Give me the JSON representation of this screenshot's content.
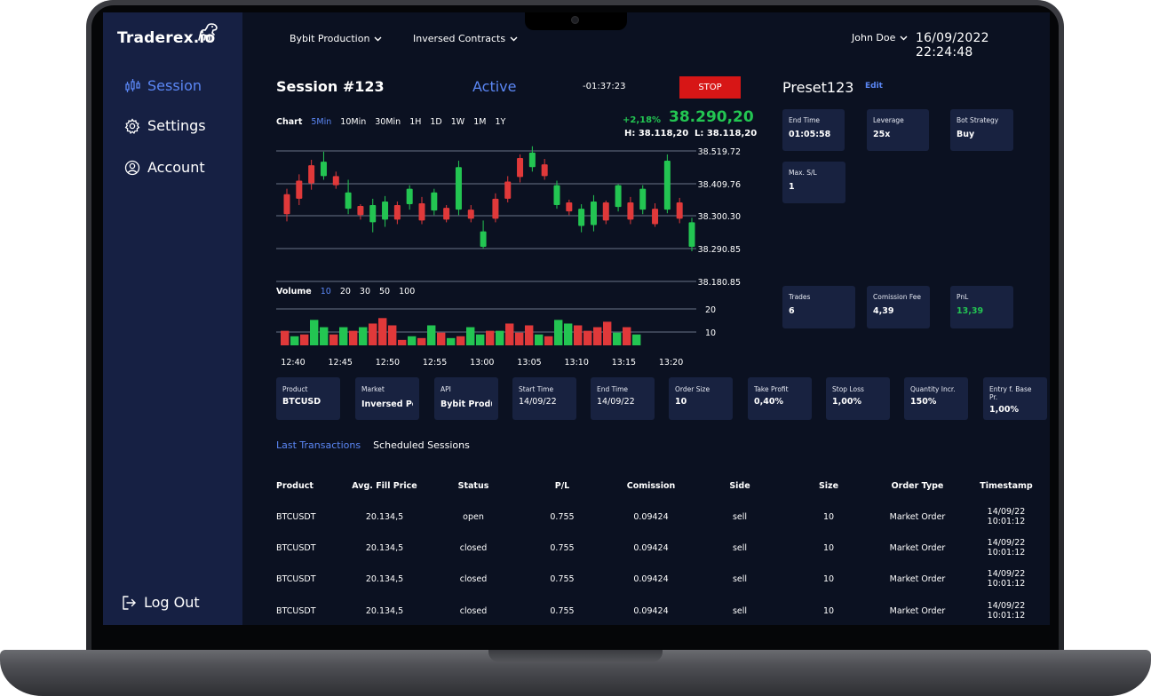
{
  "app": {
    "name": "Traderex.io",
    "accent": "#5b87f5",
    "positive": "#23c552",
    "danger": "#d71616",
    "sidebar_bg": "#162043",
    "screen_bg": "#0b1121",
    "card_bg": "#182240"
  },
  "sidebar": {
    "items": [
      {
        "label": "Session",
        "icon": "candlestick-icon",
        "active": true
      },
      {
        "label": "Settings",
        "icon": "gear-icon",
        "active": false
      },
      {
        "label": "Account",
        "icon": "user-circle-icon",
        "active": false
      }
    ],
    "logout": {
      "label": "Log Out",
      "icon": "logout-icon"
    }
  },
  "topbar": {
    "environment": "Bybit Production",
    "contracts": "Inversed Contracts",
    "user": "John Doe",
    "datetime": "16/09/2022 22:24:48"
  },
  "session": {
    "title": "Session #123",
    "status": "Active",
    "timer": "-01:37:23",
    "stop_label": "STOP"
  },
  "chart": {
    "label": "Chart",
    "timeframes": [
      "5Min",
      "10Min",
      "30Min",
      "1H",
      "1D",
      "1W",
      "1M",
      "1Y"
    ],
    "active_timeframe": "5Min",
    "change": "+2,18%",
    "last": "38.290,20",
    "high": "H: 38.118,20",
    "low": "L: 38.118,20"
  },
  "volume": {
    "label": "Volume",
    "options": [
      "10",
      "20",
      "30",
      "50",
      "100"
    ],
    "active": "10"
  },
  "chart_data": [
    {
      "type": "candlestick",
      "yticks": [
        "38.519.72",
        "38.409.76",
        "38.300.30",
        "38.290.85",
        "38.180.85"
      ],
      "ylim": [
        0,
        100
      ],
      "grid": true,
      "candles": [
        {
          "o": 38,
          "c": 60,
          "h": 66,
          "l": 30,
          "up": false
        },
        {
          "o": 55,
          "c": 75,
          "h": 82,
          "l": 48,
          "up": false
        },
        {
          "o": 72,
          "c": 92,
          "h": 98,
          "l": 65,
          "up": false
        },
        {
          "o": 96,
          "c": 80,
          "h": 107,
          "l": 76,
          "up": true
        },
        {
          "o": 70,
          "c": 80,
          "h": 85,
          "l": 66,
          "up": false
        },
        {
          "o": 62,
          "c": 44,
          "h": 76,
          "l": 38,
          "up": true
        },
        {
          "o": 37,
          "c": 47,
          "h": 49,
          "l": 32,
          "up": false
        },
        {
          "o": 48,
          "c": 29,
          "h": 55,
          "l": 18,
          "up": true
        },
        {
          "o": 52,
          "c": 32,
          "h": 58,
          "l": 24,
          "up": true
        },
        {
          "o": 32,
          "c": 48,
          "h": 52,
          "l": 27,
          "up": false
        },
        {
          "o": 49,
          "c": 66,
          "h": 70,
          "l": 43,
          "up": true
        },
        {
          "o": 31,
          "c": 50,
          "h": 57,
          "l": 27,
          "up": false
        },
        {
          "o": 62,
          "c": 42,
          "h": 66,
          "l": 37,
          "up": true
        },
        {
          "o": 32,
          "c": 45,
          "h": 48,
          "l": 29,
          "up": false
        },
        {
          "o": 90,
          "c": 43,
          "h": 97,
          "l": 37,
          "up": true
        },
        {
          "o": 33,
          "c": 43,
          "h": 48,
          "l": 29,
          "up": false
        },
        {
          "o": 19,
          "c": 2,
          "h": 31,
          "l": 0,
          "up": true
        },
        {
          "o": 33,
          "c": 55,
          "h": 61,
          "l": 29,
          "up": false
        },
        {
          "o": 55,
          "c": 74,
          "h": 80,
          "l": 51,
          "up": false
        },
        {
          "o": 79,
          "c": 100,
          "h": 104,
          "l": 73,
          "up": false
        },
        {
          "o": 106,
          "c": 90,
          "h": 113,
          "l": 85,
          "up": true
        },
        {
          "o": 80,
          "c": 93,
          "h": 99,
          "l": 76,
          "up": false
        },
        {
          "o": 70,
          "c": 48,
          "h": 75,
          "l": 44,
          "up": true
        },
        {
          "o": 41,
          "c": 51,
          "h": 54,
          "l": 37,
          "up": false
        },
        {
          "o": 44,
          "c": 25,
          "h": 49,
          "l": 18,
          "up": true
        },
        {
          "o": 26,
          "c": 52,
          "h": 59,
          "l": 19,
          "up": true
        },
        {
          "o": 31,
          "c": 51,
          "h": 53,
          "l": 27,
          "up": false
        },
        {
          "o": 46,
          "c": 70,
          "h": 71,
          "l": 41,
          "up": true
        },
        {
          "o": 32,
          "c": 51,
          "h": 57,
          "l": 27,
          "up": false
        },
        {
          "o": 66,
          "c": 43,
          "h": 70,
          "l": 38,
          "up": true
        },
        {
          "o": 27,
          "c": 44,
          "h": 50,
          "l": 24,
          "up": false
        },
        {
          "o": 43,
          "c": 97,
          "h": 104,
          "l": 39,
          "up": true
        },
        {
          "o": 33,
          "c": 51,
          "h": 56,
          "l": 28,
          "up": false
        },
        {
          "o": 29,
          "c": 2,
          "h": 34,
          "l": -3,
          "up": true
        }
      ]
    },
    {
      "type": "bar",
      "yticks": [
        "20",
        "10"
      ],
      "ylim": [
        0,
        22
      ],
      "values": [
        8,
        5,
        6,
        14,
        10,
        6,
        10,
        8,
        10,
        12,
        15,
        11,
        3,
        5,
        4,
        11,
        7,
        4,
        5,
        10,
        6,
        8,
        8,
        12,
        7,
        11,
        6,
        5,
        14,
        12,
        11,
        8,
        10,
        13,
        7,
        10,
        6
      ],
      "colors": [
        "r",
        "g",
        "r",
        "g",
        "g",
        "r",
        "g",
        "r",
        "g",
        "r",
        "r",
        "r",
        "r",
        "g",
        "r",
        "g",
        "r",
        "g",
        "r",
        "g",
        "g",
        "r",
        "g",
        "r",
        "r",
        "r",
        "g",
        "r",
        "g",
        "g",
        "r",
        "r",
        "r",
        "r",
        "g",
        "r",
        "g"
      ],
      "xlabels": [
        "12:40",
        "12:45",
        "12:50",
        "12:55",
        "13:00",
        "13:05",
        "13:10",
        "13:15",
        "13:20"
      ]
    }
  ],
  "preset": {
    "name": "Preset123",
    "edit_label": "Edit",
    "cards": [
      {
        "label": "End Time",
        "value": "01:05:58"
      },
      {
        "label": "Leverage",
        "value": "25x"
      },
      {
        "label": "Bot Strategy",
        "value": "Buy"
      },
      {
        "label": "Max. S/L",
        "value": "1"
      }
    ],
    "stats": [
      {
        "label": "Trades",
        "value": "6"
      },
      {
        "label": "Comission Fee",
        "value": "4,39"
      },
      {
        "label": "PnL",
        "value": "13,39"
      }
    ]
  },
  "params": [
    {
      "label": "Product",
      "value": "BTCUSD"
    },
    {
      "label": "Market",
      "value": "Inversed Perpetual"
    },
    {
      "label": "API",
      "value": "Bybit Production"
    },
    {
      "label": "Start Time",
      "value": "14/09/22"
    },
    {
      "label": "End Time",
      "value": "14/09/22"
    },
    {
      "label": "Order Size",
      "value": "10"
    },
    {
      "label": "Take Profit",
      "value": "0,40%"
    },
    {
      "label": "Stop Loss",
      "value": "1,00%"
    },
    {
      "label": "Quantity Incr.",
      "value": "150%"
    },
    {
      "label": "Entry f. Base Pr.",
      "value": "1,00%"
    }
  ],
  "tabs": [
    {
      "label": "Last Transactions",
      "active": true
    },
    {
      "label": "Scheduled Sessions",
      "active": false
    }
  ],
  "transactions": {
    "columns": [
      "Product",
      "Avg. Fill Price",
      "Status",
      "P/L",
      "Comission",
      "Side",
      "Size",
      "Order Type",
      "Timestamp"
    ],
    "rows": [
      {
        "product": "BTCUSDT",
        "price": "20.134,5",
        "status": "open",
        "pl": "0.755",
        "comission": "0.09424",
        "side": "sell",
        "size": "10",
        "type": "Market Order",
        "date": "14/09/22",
        "time": "10:01:12"
      },
      {
        "product": "BTCUSDT",
        "price": "20.134,5",
        "status": "closed",
        "pl": "0.755",
        "comission": "0.09424",
        "side": "sell",
        "size": "10",
        "type": "Market Order",
        "date": "14/09/22",
        "time": "10:01:12"
      },
      {
        "product": "BTCUSDT",
        "price": "20.134,5",
        "status": "closed",
        "pl": "0.755",
        "comission": "0.09424",
        "side": "sell",
        "size": "10",
        "type": "Market Order",
        "date": "14/09/22",
        "time": "10:01:12"
      },
      {
        "product": "BTCUSDT",
        "price": "20.134,5",
        "status": "closed",
        "pl": "0.755",
        "comission": "0.09424",
        "side": "sell",
        "size": "10",
        "type": "Market Order",
        "date": "14/09/22",
        "time": "10:01:12"
      }
    ]
  }
}
